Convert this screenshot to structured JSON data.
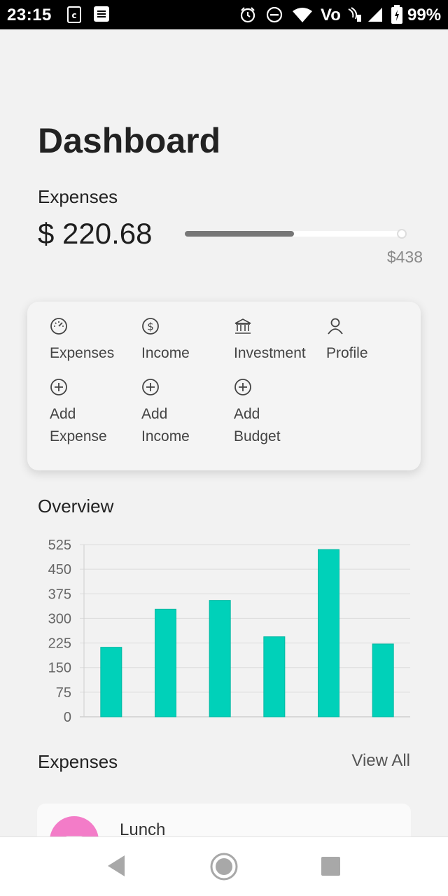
{
  "status_bar": {
    "time": "23:15",
    "battery": "99%",
    "network": "Vo",
    "icons": [
      "notification-c-icon",
      "notification-list-icon",
      "alarm-icon",
      "dnd-icon",
      "wifi-icon",
      "volte-icon",
      "signal-icon",
      "battery-icon"
    ]
  },
  "header": {
    "title": "Dashboard"
  },
  "summary": {
    "label": "Expenses",
    "amount": "$ 220.68",
    "max_label": "$438",
    "progress_fraction": 0.5
  },
  "menu": {
    "items": [
      {
        "label": "Expenses",
        "icon": "speedometer-icon"
      },
      {
        "label": "Income",
        "icon": "dollar-circle-icon"
      },
      {
        "label": "Investment",
        "icon": "bank-icon"
      },
      {
        "label": "Profile",
        "icon": "user-icon"
      },
      {
        "label": "Add\nExpense",
        "icon": "plus-circle-icon"
      },
      {
        "label": "Add\nIncome",
        "icon": "plus-circle-icon"
      },
      {
        "label": "Add\nBudget",
        "icon": "plus-circle-icon"
      }
    ]
  },
  "overview": {
    "title": "Overview"
  },
  "chart_data": {
    "type": "bar",
    "categories": [
      "",
      "",
      "",
      "",
      "",
      ""
    ],
    "values": [
      212,
      328,
      355,
      244,
      510,
      222
    ],
    "yticks": [
      "525",
      "450",
      "375",
      "300",
      "225",
      "150",
      "75",
      "0"
    ],
    "ylim": [
      0,
      525
    ],
    "grid": true,
    "color": "#00d1b9"
  },
  "expenses_section": {
    "title": "Expenses",
    "view_all": "View All",
    "items": [
      {
        "name": "Lunch",
        "icon": "dining-icon",
        "color": "#f37cc8"
      }
    ]
  },
  "nav": {
    "icons": [
      "back-icon",
      "home-icon",
      "recents-icon"
    ]
  }
}
